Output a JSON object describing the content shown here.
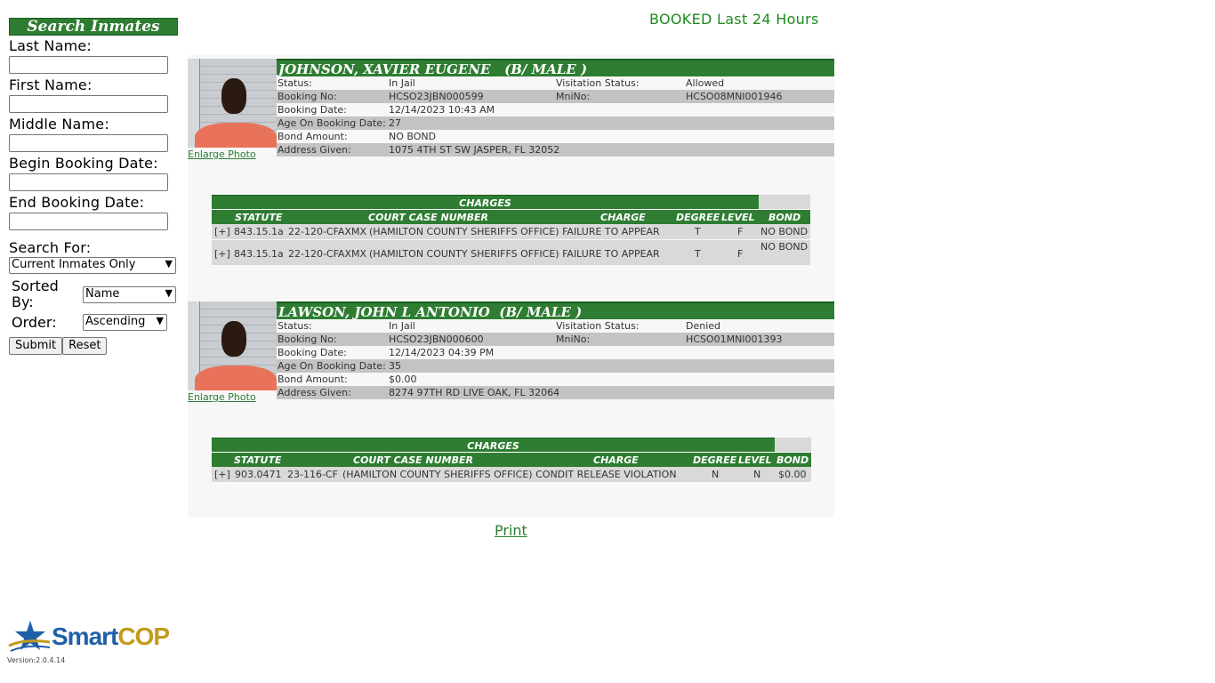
{
  "sidebar": {
    "title": "Search Inmates",
    "labels": {
      "last_name": "Last Name:",
      "first_name": "First Name:",
      "middle_name": "Middle Name:",
      "begin_booking": "Begin Booking Date:",
      "end_booking": "End Booking Date:",
      "search_for": "Search For:",
      "sorted_by_1": "Sorted",
      "sorted_by_2": "By:",
      "order": "Order:"
    },
    "inputs": {
      "last_name": "",
      "first_name": "",
      "middle_name": "",
      "begin_booking": "",
      "end_booking": ""
    },
    "selects": {
      "search_for": "Current Inmates Only",
      "sorted_by": "Name",
      "order": "Ascending"
    },
    "buttons": {
      "submit": "Submit",
      "reset": "Reset"
    }
  },
  "header": {
    "booked": "BOOKED Last 24 Hours"
  },
  "labels": {
    "status": "Status:",
    "visitation": "Visitation Status:",
    "booking_no": "Booking No:",
    "mnino": "MniNo:",
    "booking_date": "Booking Date:",
    "age": "Age On Booking Date:",
    "bond": "Bond Amount:",
    "address": "Address Given:",
    "enlarge": "Enlarge Photo",
    "charges_title": "CHARGES",
    "col_statute": "STATUTE",
    "col_case": "COURT CASE NUMBER",
    "col_charge": "CHARGE",
    "col_degree": "DEGREE",
    "col_level": "LEVEL",
    "col_bond": "BOND"
  },
  "inmates": [
    {
      "name": "JOHNSON, XAVIER EUGENE   (B/ MALE )",
      "status": "In Jail",
      "visitation": "Allowed",
      "booking_no": "HCSO23JBN000599",
      "mnino": "HCSO08MNI001946",
      "booking_date": "12/14/2023 10:43 AM",
      "age": "27",
      "bond": "NO BOND",
      "address": "1075 4TH ST SW JASPER, FL 32052",
      "charges": [
        {
          "expand": "[+]",
          "statute": "843.15.1a",
          "case": "22-120-CFAXMX",
          "charge": "(HAMILTON COUNTY SHERIFFS OFFICE) FAILURE TO APPEAR",
          "degree": "T",
          "level": "F",
          "bond": "NO BOND"
        },
        {
          "expand": "[+]",
          "statute": "843.15.1a",
          "case": "22-120-CFAXMX",
          "charge": "(HAMILTON COUNTY SHERIFFS OFFICE) FAILURE TO APPEAR",
          "degree": "T",
          "level": "F",
          "bond": "NO BOND"
        }
      ]
    },
    {
      "name": "LAWSON, JOHN L ANTONIO  (B/ MALE )",
      "status": "In Jail",
      "visitation": "Denied",
      "booking_no": "HCSO23JBN000600",
      "mnino": "HCSO01MNI001393",
      "booking_date": "12/14/2023 04:39 PM",
      "age": "35",
      "bond": "$0.00",
      "address": "8274 97TH RD LIVE OAK, FL 32064",
      "charges": [
        {
          "expand": "[+]",
          "statute": "903.0471",
          "case": "23-116-CF",
          "charge": "(HAMILTON COUNTY SHERIFFS OFFICE) CONDIT RELEASE VIOLATION",
          "degree": "N",
          "level": "N",
          "bond": "$0.00"
        }
      ]
    }
  ],
  "footer": {
    "print": "Print",
    "logo_smart": "Smart",
    "logo_cop": "COP",
    "version": "Version:2.0.4.14"
  }
}
